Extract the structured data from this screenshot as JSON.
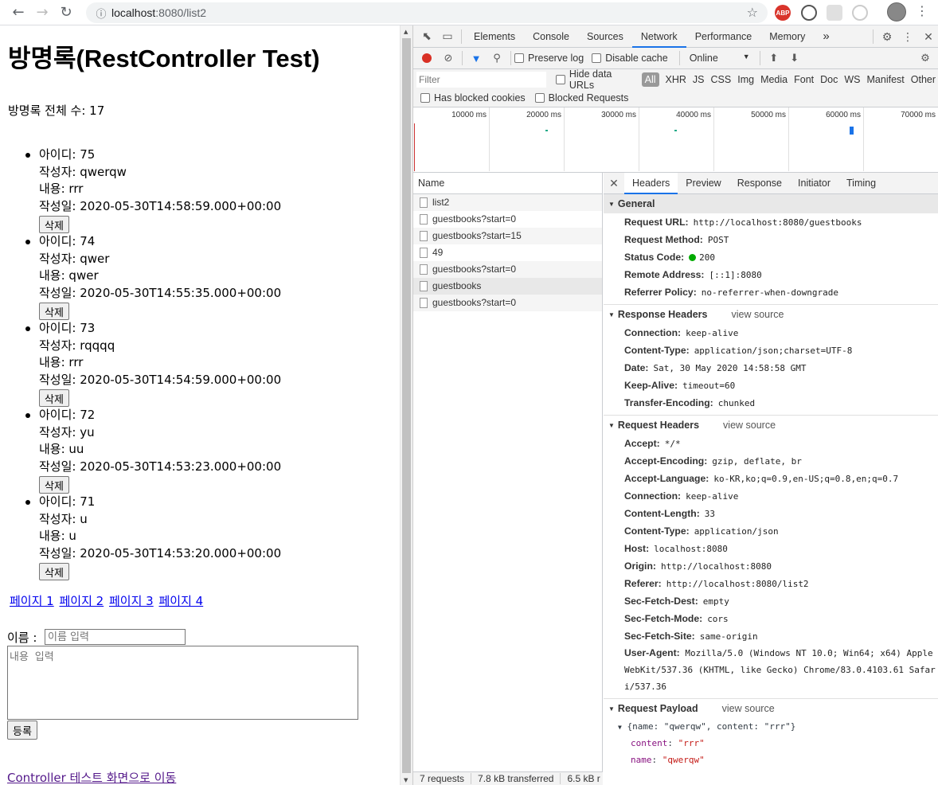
{
  "browser": {
    "url_host": "localhost",
    "url_rest": ":8080/list2",
    "ext_abp": "ABP"
  },
  "page": {
    "title": "방명록(RestController Test)",
    "total": "방명록 전체 수: 17",
    "delete_label": "삭제",
    "entries": [
      {
        "id": "아이디: 75",
        "author": "작성자: qwerqw",
        "content": "내용: rrr",
        "date": "작성일: 2020-05-30T14:58:59.000+00:00"
      },
      {
        "id": "아이디: 74",
        "author": "작성자: qwer",
        "content": "내용: qwer",
        "date": "작성일: 2020-05-30T14:55:35.000+00:00"
      },
      {
        "id": "아이디: 73",
        "author": "작성자: rqqqq",
        "content": "내용: rrr",
        "date": "작성일: 2020-05-30T14:54:59.000+00:00"
      },
      {
        "id": "아이디: 72",
        "author": "작성자: yu",
        "content": "내용: uu",
        "date": "작성일: 2020-05-30T14:53:23.000+00:00"
      },
      {
        "id": "아이디: 71",
        "author": "작성자: u",
        "content": "내용: u",
        "date": "작성일: 2020-05-30T14:53:20.000+00:00"
      }
    ],
    "pages": [
      "페이지 1",
      "페이지 2",
      "페이지 3",
      "페이지 4"
    ],
    "name_label": "이름 :",
    "name_placeholder": "이름 입력",
    "content_placeholder": "내용 입력",
    "submit_label": "등록",
    "controller_link": "Controller 테스트 화면으로 이동"
  },
  "devtools": {
    "tabs": [
      "Elements",
      "Console",
      "Sources",
      "Network",
      "Performance",
      "Memory"
    ],
    "active_tab": "Network",
    "more": "»",
    "preserve_log": "Preserve log",
    "disable_cache": "Disable cache",
    "throttle": "Online",
    "filter_placeholder": "Filter",
    "hide_data_urls": "Hide data URLs",
    "types": [
      "All",
      "XHR",
      "JS",
      "CSS",
      "Img",
      "Media",
      "Font",
      "Doc",
      "WS",
      "Manifest",
      "Other"
    ],
    "blocked_cookies": "Has blocked cookies",
    "blocked_requests": "Blocked Requests",
    "timeline_ticks": [
      "10000 ms",
      "20000 ms",
      "30000 ms",
      "40000 ms",
      "50000 ms",
      "60000 ms",
      "70000 ms"
    ],
    "name_header": "Name",
    "requests": [
      "list2",
      "guestbooks?start=0",
      "guestbooks?start=15",
      "49",
      "guestbooks?start=0",
      "guestbooks",
      "guestbooks?start=0"
    ],
    "selected_request_index": 5,
    "status": [
      "7 requests",
      "7.8 kB transferred",
      "6.5 kB r"
    ],
    "header_tabs": [
      "Headers",
      "Preview",
      "Response",
      "Initiator",
      "Timing"
    ],
    "view_source": "view source",
    "general_title": "General",
    "general": [
      {
        "k": "Request URL:",
        "v": "http://localhost:8080/guestbooks"
      },
      {
        "k": "Request Method:",
        "v": "POST"
      },
      {
        "k": "Status Code:",
        "v": "200"
      },
      {
        "k": "Remote Address:",
        "v": "[::1]:8080"
      },
      {
        "k": "Referrer Policy:",
        "v": "no-referrer-when-downgrade"
      }
    ],
    "response_title": "Response Headers",
    "response_headers": [
      {
        "k": "Connection:",
        "v": "keep-alive"
      },
      {
        "k": "Content-Type:",
        "v": "application/json;charset=UTF-8"
      },
      {
        "k": "Date:",
        "v": "Sat, 30 May 2020 14:58:58 GMT"
      },
      {
        "k": "Keep-Alive:",
        "v": "timeout=60"
      },
      {
        "k": "Transfer-Encoding:",
        "v": "chunked"
      }
    ],
    "request_title": "Request Headers",
    "request_headers": [
      {
        "k": "Accept:",
        "v": "*/*"
      },
      {
        "k": "Accept-Encoding:",
        "v": "gzip, deflate, br"
      },
      {
        "k": "Accept-Language:",
        "v": "ko-KR,ko;q=0.9,en-US;q=0.8,en;q=0.7"
      },
      {
        "k": "Connection:",
        "v": "keep-alive"
      },
      {
        "k": "Content-Length:",
        "v": "33"
      },
      {
        "k": "Content-Type:",
        "v": "application/json"
      },
      {
        "k": "Host:",
        "v": "localhost:8080"
      },
      {
        "k": "Origin:",
        "v": "http://localhost:8080"
      },
      {
        "k": "Referer:",
        "v": "http://localhost:8080/list2"
      },
      {
        "k": "Sec-Fetch-Dest:",
        "v": "empty"
      },
      {
        "k": "Sec-Fetch-Mode:",
        "v": "cors"
      },
      {
        "k": "Sec-Fetch-Site:",
        "v": "same-origin"
      }
    ],
    "user_agent_key": "User-Agent:",
    "user_agent_value": "Mozilla/5.0 (Windows NT 10.0; Win64; x64) AppleWebKit/537.36 (KHTML, like Gecko) Chrome/83.0.4103.61 Safari/537.36",
    "payload_title": "Request Payload",
    "payload_summary": "{name: \"qwerqw\", content: \"rrr\"}",
    "payload": [
      {
        "k": "content",
        "v": "\"rrr\""
      },
      {
        "k": "name",
        "v": "\"qwerqw\""
      }
    ]
  },
  "colors": {
    "record": "#d93025",
    "status_ok": "#00aa00",
    "link": "#0000ee",
    "visited": "#551a8b",
    "accent": "#1a73e8"
  }
}
